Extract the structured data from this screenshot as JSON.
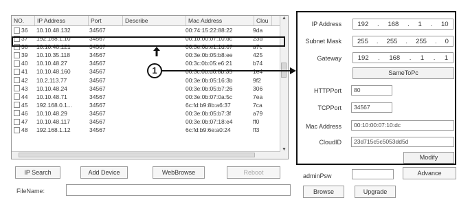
{
  "table": {
    "headers": [
      "NO.",
      "IP Address",
      "Port",
      "Describe",
      "Mac Address",
      "Clou"
    ],
    "rows": [
      {
        "no": "36",
        "ip": "10.10.48.132",
        "port": "34567",
        "desc": "",
        "mac": "00:74:15:22:88:22",
        "cloud": "9da"
      },
      {
        "no": "37",
        "ip": "192.168.1.10",
        "port": "34567",
        "desc": "",
        "mac": "00:10:00:07:10:dc",
        "cloud": "23d"
      },
      {
        "no": "38",
        "ip": "10.10.48.121",
        "port": "34567",
        "desc": "",
        "mac": "00:3e:0b:e1:1d:67",
        "cloud": "a7c"
      },
      {
        "no": "39",
        "ip": "10.10.35.118",
        "port": "34567",
        "desc": "",
        "mac": "00:3e:0b:05:b8:ee",
        "cloud": "425"
      },
      {
        "no": "40",
        "ip": "10.10.48.27",
        "port": "34567",
        "desc": "",
        "mac": "00:3c:0b:05:e6:21",
        "cloud": "b74"
      },
      {
        "no": "41",
        "ip": "10.10.48.160",
        "port": "34567",
        "desc": "",
        "mac": "00:3c:0b:d0:8b:35",
        "cloud": "1e4"
      },
      {
        "no": "42",
        "ip": "10.2.113.77",
        "port": "34567",
        "desc": "",
        "mac": "00:3e:0b:05:16:3b",
        "cloud": "9f2"
      },
      {
        "no": "43",
        "ip": "10.10.48.24",
        "port": "34567",
        "desc": "",
        "mac": "00:3e:0b:05:b7:26",
        "cloud": "306"
      },
      {
        "no": "44",
        "ip": "10.10.48.71",
        "port": "34567",
        "desc": "",
        "mac": "00:3e:0b:07:0a:5c",
        "cloud": "7ea"
      },
      {
        "no": "45",
        "ip": "192.168.0.1...",
        "port": "34567",
        "desc": "",
        "mac": "6c:fd:b9:8b:a6:37",
        "cloud": "7ca"
      },
      {
        "no": "46",
        "ip": "10.10.48.29",
        "port": "34567",
        "desc": "",
        "mac": "00:3e:0b:05:b7:3f",
        "cloud": "a79"
      },
      {
        "no": "47",
        "ip": "10.10.48.117",
        "port": "34567",
        "desc": "",
        "mac": "00:3e:0b:07:18:e4",
        "cloud": "ff0"
      },
      {
        "no": "48",
        "ip": "192.168.1.12",
        "port": "34567",
        "desc": "",
        "mac": "6c:fd:b9:6e:a0:24",
        "cloud": "ff3"
      }
    ]
  },
  "annotation": {
    "callout": "1"
  },
  "config": {
    "ip_label": "IP Address",
    "ip": [
      "192",
      "168",
      "1",
      "10"
    ],
    "mask_label": "Subnet Mask",
    "mask": [
      "255",
      "255",
      "255",
      "0"
    ],
    "gateway_label": "Gateway",
    "gateway": [
      "192",
      "168",
      "1",
      "1"
    ],
    "same_button": "SameToPc",
    "http_label": "HTTPPort",
    "http_port": "80",
    "tcp_label": "TCPPort",
    "tcp_port": "34567",
    "mac_label": "Mac Address",
    "mac": "00:10:00:07:10:dc",
    "cloud_label": "CloudID",
    "cloud_id": "23d715c5c5053dd5d",
    "modify_button": "Modify"
  },
  "bottom": {
    "ip_search": "IP Search",
    "add_device": "Add Device",
    "web_browse": "WebBrowse",
    "reboot": "Reboot",
    "admin_label": "adminPsw",
    "advance": "Advance",
    "browse": "Browse",
    "upgrade": "Upgrade",
    "filename_label": "FileName:"
  }
}
